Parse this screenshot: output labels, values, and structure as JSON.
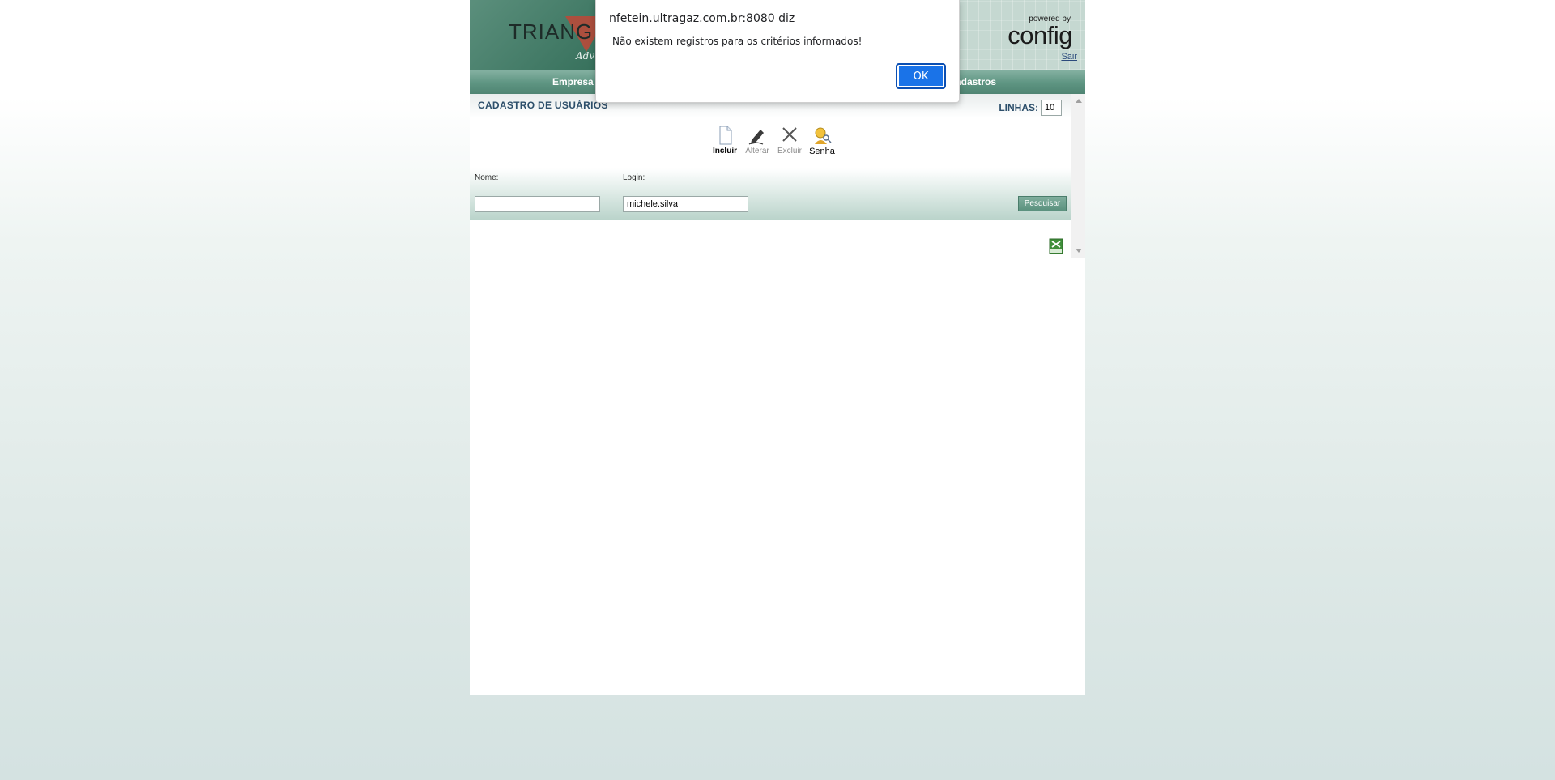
{
  "header": {
    "logo_text": "TRIANG",
    "logo_sub": "Adv",
    "powered_by": "powered by",
    "brand": "config",
    "sair": "Sair"
  },
  "nav": {
    "items": [
      {
        "label": "Empresa"
      },
      {
        "label": "adastros"
      }
    ]
  },
  "page": {
    "title": "CADASTRO DE USUÁRIOS",
    "linhas_label": "LINHAS:",
    "linhas_value": "10"
  },
  "toolbar": {
    "incluir": "Incluir",
    "alterar": "Alterar",
    "excluir": "Excluir",
    "senha": "Senha"
  },
  "filters": {
    "nome_label": "Nome:",
    "nome_value": "",
    "login_label": "Login:",
    "login_value": "michele.silva",
    "search_button": "Pesquisar"
  },
  "dialog": {
    "title": "nfetein.ultragaz.com.br:8080 diz",
    "message": "Não existem registros para os critérios informados!",
    "ok": "OK"
  },
  "colors": {
    "nav_green": "#5e9582",
    "title_blue": "#2d4f6b",
    "dialog_button": "#1a73e8"
  }
}
